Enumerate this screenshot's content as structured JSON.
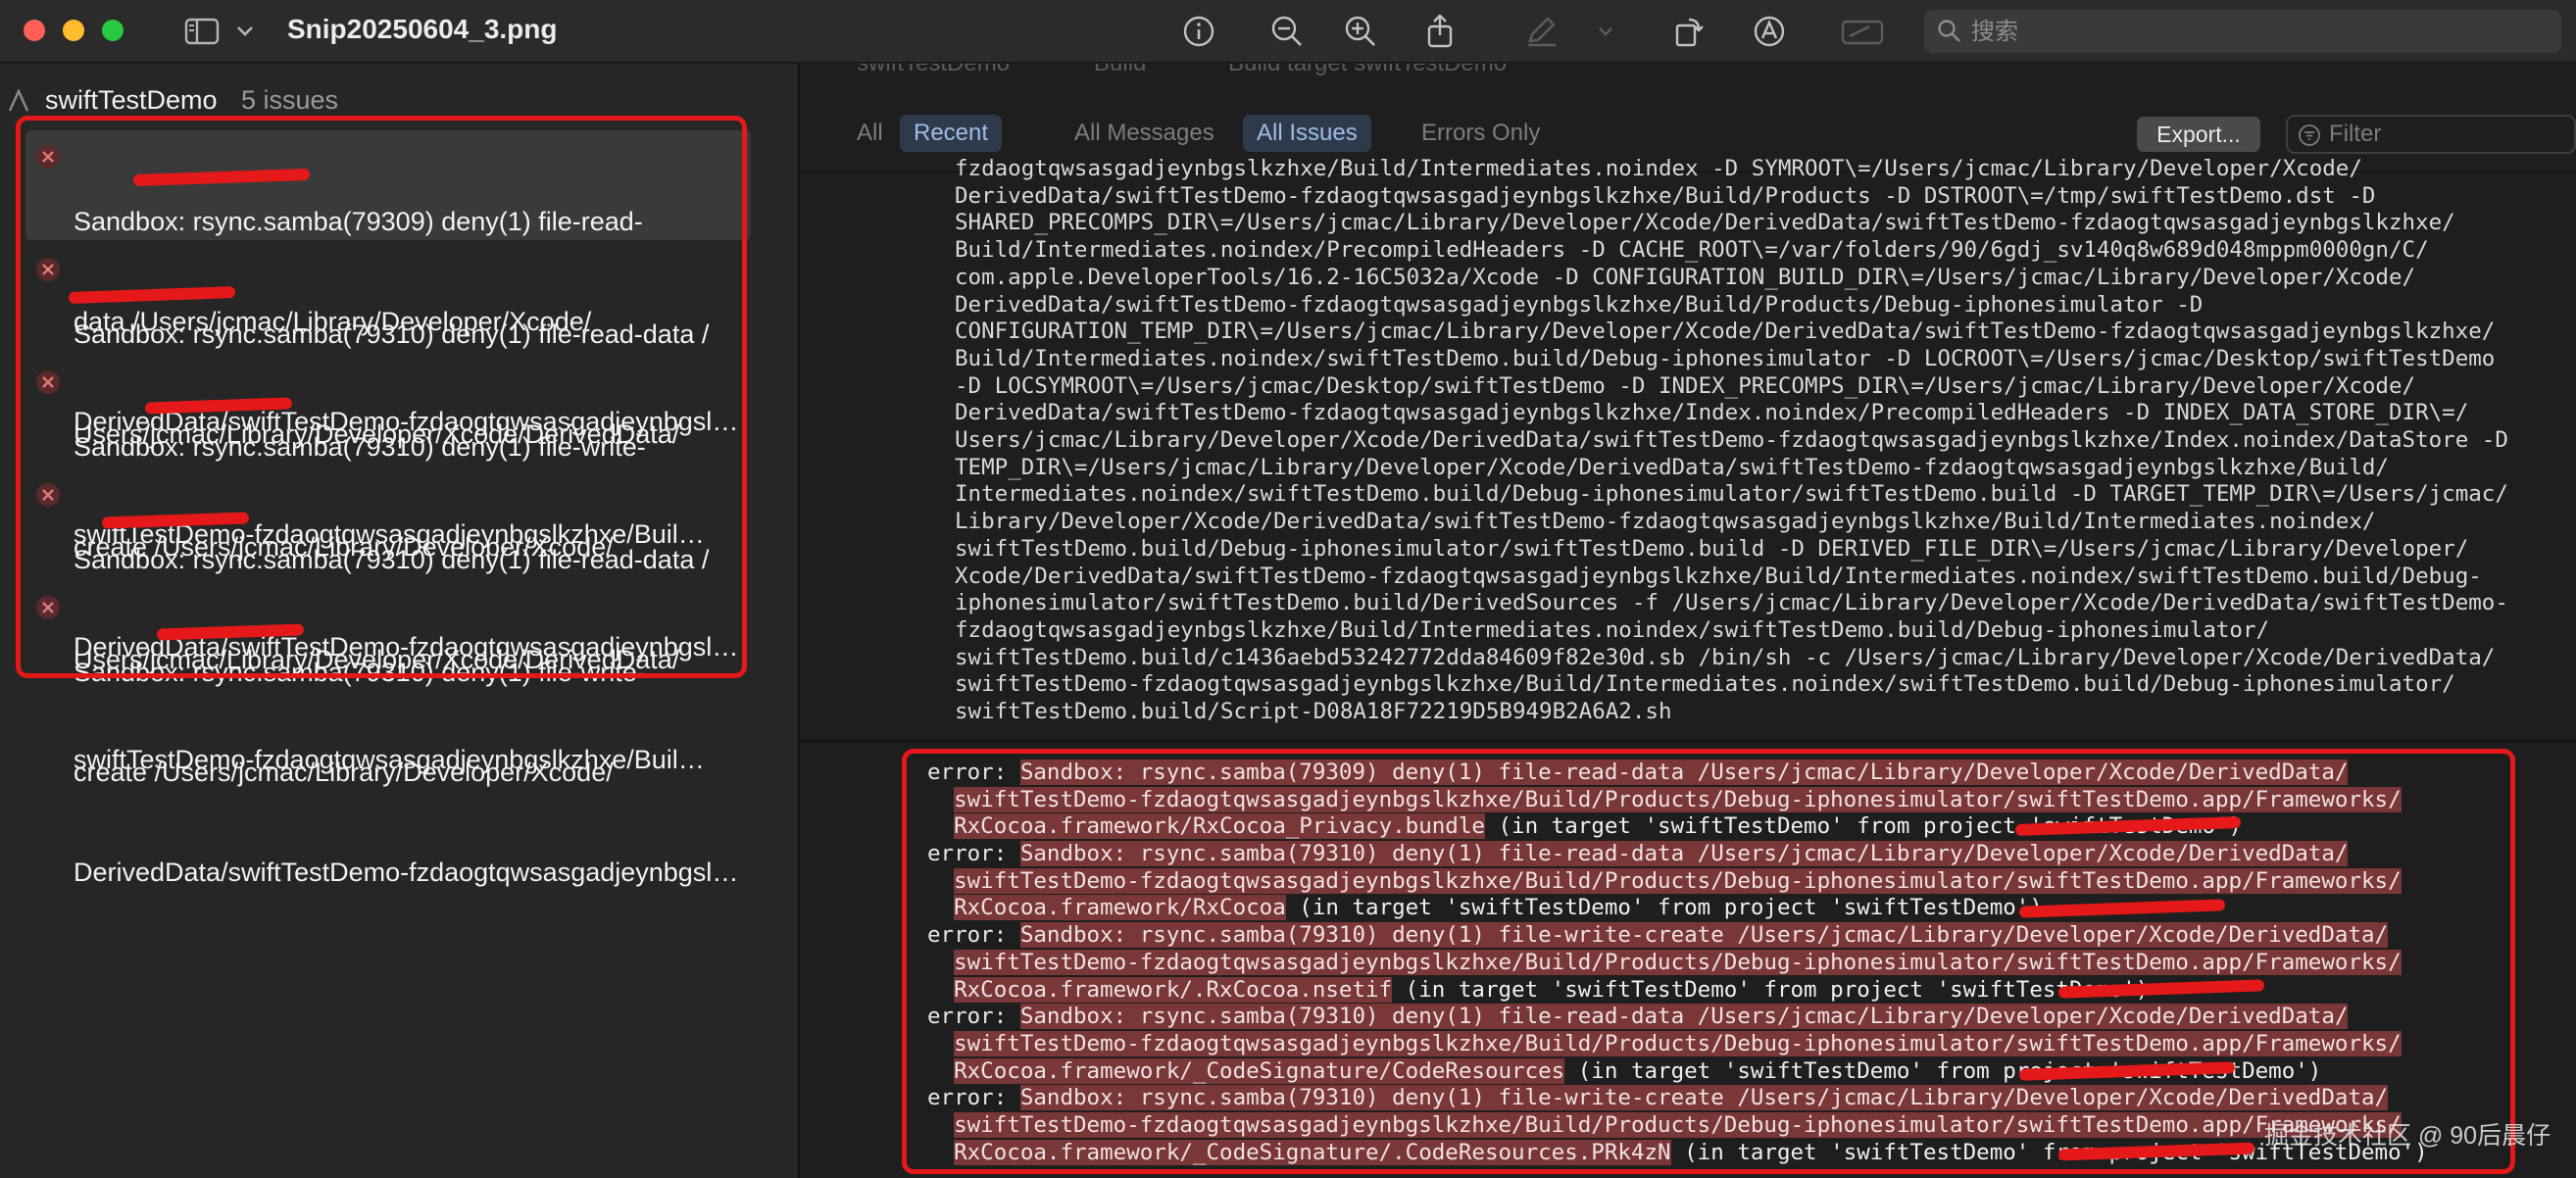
{
  "window": {
    "title": "Snip20250604_3.png",
    "traffic_lights": {
      "close": "#fe5f57",
      "minimize": "#febc2e",
      "zoom": "#28c840"
    }
  },
  "toolbar": {
    "icons": [
      "sidebar-toggle-icon",
      "chevron-down-icon",
      "info-icon",
      "zoom-out-icon",
      "zoom-in-icon",
      "share-icon",
      "markup-icon",
      "rotate-icon",
      "annotate-icon",
      "signature-icon"
    ],
    "search_placeholder": "搜索"
  },
  "sidebar": {
    "project": "swiftTestDemo",
    "issue_count": "5 issues",
    "issues": [
      {
        "lines": [
          "Sandbox: rsync.samba(79309) deny(1) file-read-",
          "data /Users/jcmac/Library/Developer/Xcode/",
          "DerivedData/swiftTestDemo-fzdaogtqwsasgadjeynbgslkzhxe/Buil…"
        ]
      },
      {
        "lines": [
          "Sandbox: rsync.samba(79310) deny(1) file-read-data /",
          "Users/jcmac/Library/Developer/Xcode/DerivedData/",
          "swiftTestDemo-fzdaogtqwsasgadjeynbgslkzhxe/Buil…"
        ]
      },
      {
        "lines": [
          "Sandbox: rsync.samba(79310) deny(1) file-write-",
          "create /Users/jcmac/Library/Developer/Xcode/",
          "DerivedData/swiftTestDemo-fzdaogtqwsasgadjeynbgslkzhxe/Buil…"
        ]
      },
      {
        "lines": [
          "Sandbox: rsync.samba(79310) deny(1) file-read-data /",
          "Users/jcmac/Library/Developer/Xcode/DerivedData/",
          "swiftTestDemo-fzdaogtqwsasgadjeynbgslkzhxe/Buil…"
        ]
      },
      {
        "lines": [
          "Sandbox: rsync.samba(79310) deny(1) file-write-",
          "create /Users/jcmac/Library/Developer/Xcode/",
          "DerivedData/swiftTestDemo-fzdaogtqwsasgadjeynbgslkzhxe/Buil…"
        ]
      }
    ]
  },
  "breadcrumb": {
    "project": "swiftTestDemo",
    "build": "Build",
    "target": "Build target swiftTestDemo"
  },
  "filterbar": {
    "all": "All",
    "recent": "Recent",
    "all_messages": "All Messages",
    "all_issues": "All Issues",
    "errors_only": "Errors Only",
    "export": "Export...",
    "filter_placeholder": "Filter"
  },
  "log_lines": [
    "fzdaogtqwsasgadjeynbgslkzhxe/Build/Intermediates.noindex -D SYMROOT\\=/Users/jcmac/Library/Developer/Xcode/",
    "DerivedData/swiftTestDemo-fzdaogtqwsasgadjeynbgslkzhxe/Build/Products -D DSTROOT\\=/tmp/swiftTestDemo.dst -D",
    "SHARED_PRECOMPS_DIR\\=/Users/jcmac/Library/Developer/Xcode/DerivedData/swiftTestDemo-fzdaogtqwsasgadjeynbgslkzhxe/",
    "Build/Intermediates.noindex/PrecompiledHeaders -D CACHE_ROOT\\=/var/folders/90/6gdj_sv140q8w689d048mppm0000gn/C/",
    "com.apple.DeveloperTools/16.2-16C5032a/Xcode -D CONFIGURATION_BUILD_DIR\\=/Users/jcmac/Library/Developer/Xcode/",
    "DerivedData/swiftTestDemo-fzdaogtqwsasgadjeynbgslkzhxe/Build/Products/Debug-iphonesimulator -D",
    "CONFIGURATION_TEMP_DIR\\=/Users/jcmac/Library/Developer/Xcode/DerivedData/swiftTestDemo-fzdaogtqwsasgadjeynbgslkzhxe/",
    "Build/Intermediates.noindex/swiftTestDemo.build/Debug-iphonesimulator -D LOCROOT\\=/Users/jcmac/Desktop/swiftTestDemo",
    "-D LOCSYMROOT\\=/Users/jcmac/Desktop/swiftTestDemo -D INDEX_PRECOMPS_DIR\\=/Users/jcmac/Library/Developer/Xcode/",
    "DerivedData/swiftTestDemo-fzdaogtqwsasgadjeynbgslkzhxe/Index.noindex/PrecompiledHeaders -D INDEX_DATA_STORE_DIR\\=/",
    "Users/jcmac/Library/Developer/Xcode/DerivedData/swiftTestDemo-fzdaogtqwsasgadjeynbgslkzhxe/Index.noindex/DataStore -D",
    "TEMP_DIR\\=/Users/jcmac/Library/Developer/Xcode/DerivedData/swiftTestDemo-fzdaogtqwsasgadjeynbgslkzhxe/Build/",
    "Intermediates.noindex/swiftTestDemo.build/Debug-iphonesimulator/swiftTestDemo.build -D TARGET_TEMP_DIR\\=/Users/jcmac/",
    "Library/Developer/Xcode/DerivedData/swiftTestDemo-fzdaogtqwsasgadjeynbgslkzhxe/Build/Intermediates.noindex/",
    "swiftTestDemo.build/Debug-iphonesimulator/swiftTestDemo.build -D DERIVED_FILE_DIR\\=/Users/jcmac/Library/Developer/",
    "Xcode/DerivedData/swiftTestDemo-fzdaogtqwsasgadjeynbgslkzhxe/Build/Intermediates.noindex/swiftTestDemo.build/Debug-",
    "iphonesimulator/swiftTestDemo.build/DerivedSources -f /Users/jcmac/Library/Developer/Xcode/DerivedData/swiftTestDemo-",
    "fzdaogtqwsasgadjeynbgslkzhxe/Build/Intermediates.noindex/swiftTestDemo.build/Debug-iphonesimulator/",
    "swiftTestDemo.build/c1436aebd53242772dda84609f82e30d.sb /bin/sh -c /Users/jcmac/Library/Developer/Xcode/DerivedData/",
    "swiftTestDemo-fzdaogtqwsasgadjeynbgslkzhxe/Build/Intermediates.noindex/swiftTestDemo.build/Debug-iphonesimulator/",
    "swiftTestDemo.build/Script-D08A18F72219D5B949B2A6A2.sh"
  ],
  "errors": [
    {
      "label": "error:",
      "lines": [
        "Sandbox: rsync.samba(79309) deny(1) file-read-data /Users/jcmac/Library/Developer/Xcode/DerivedData/",
        "swiftTestDemo-fzdaogtqwsasgadjeynbgslkzhxe/Build/Products/Debug-iphonesimulator/swiftTestDemo.app/Frameworks/",
        "RxCocoa.framework/RxCocoa_Privacy.bundle"
      ],
      "suffix": " (in target 'swiftTestDemo' from project 'swiftTestDemo')"
    },
    {
      "label": "error:",
      "lines": [
        "Sandbox: rsync.samba(79310) deny(1) file-read-data /Users/jcmac/Library/Developer/Xcode/DerivedData/",
        "swiftTestDemo-fzdaogtqwsasgadjeynbgslkzhxe/Build/Products/Debug-iphonesimulator/swiftTestDemo.app/Frameworks/",
        "RxCocoa.framework/RxCocoa"
      ],
      "suffix": " (in target 'swiftTestDemo' from project 'swiftTestDemo')"
    },
    {
      "label": "error:",
      "lines": [
        "Sandbox: rsync.samba(79310) deny(1) file-write-create /Users/jcmac/Library/Developer/Xcode/DerivedData/",
        "swiftTestDemo-fzdaogtqwsasgadjeynbgslkzhxe/Build/Products/Debug-iphonesimulator/swiftTestDemo.app/Frameworks/",
        "RxCocoa.framework/.RxCocoa.nsetif"
      ],
      "suffix": " (in target 'swiftTestDemo' from project 'swiftTestDemo')"
    },
    {
      "label": "error:",
      "lines": [
        "Sandbox: rsync.samba(79310) deny(1) file-read-data /Users/jcmac/Library/Developer/Xcode/DerivedData/",
        "swiftTestDemo-fzdaogtqwsasgadjeynbgslkzhxe/Build/Products/Debug-iphonesimulator/swiftTestDemo.app/Frameworks/",
        "RxCocoa.framework/_CodeSignature/CodeResources"
      ],
      "suffix": " (in target 'swiftTestDemo' from project 'swiftTestDemo')"
    },
    {
      "label": "error:",
      "lines": [
        "Sandbox: rsync.samba(79310) deny(1) file-write-create /Users/jcmac/Library/Developer/Xcode/DerivedData/",
        "swiftTestDemo-fzdaogtqwsasgadjeynbgslkzhxe/Build/Products/Debug-iphonesimulator/swiftTestDemo.app/Frameworks/",
        "RxCocoa.framework/_CodeSignature/.CodeResources.PRk4zN"
      ],
      "suffix": " (in target 'swiftTestDemo' from project 'swiftTestDemo')"
    }
  ],
  "watermark": "掘金技术社区 @ 90后晨仔",
  "colors": {
    "error_red": "#e51919",
    "error_highlight": "#7a3737",
    "selected_chip": "#2e3a4c"
  }
}
